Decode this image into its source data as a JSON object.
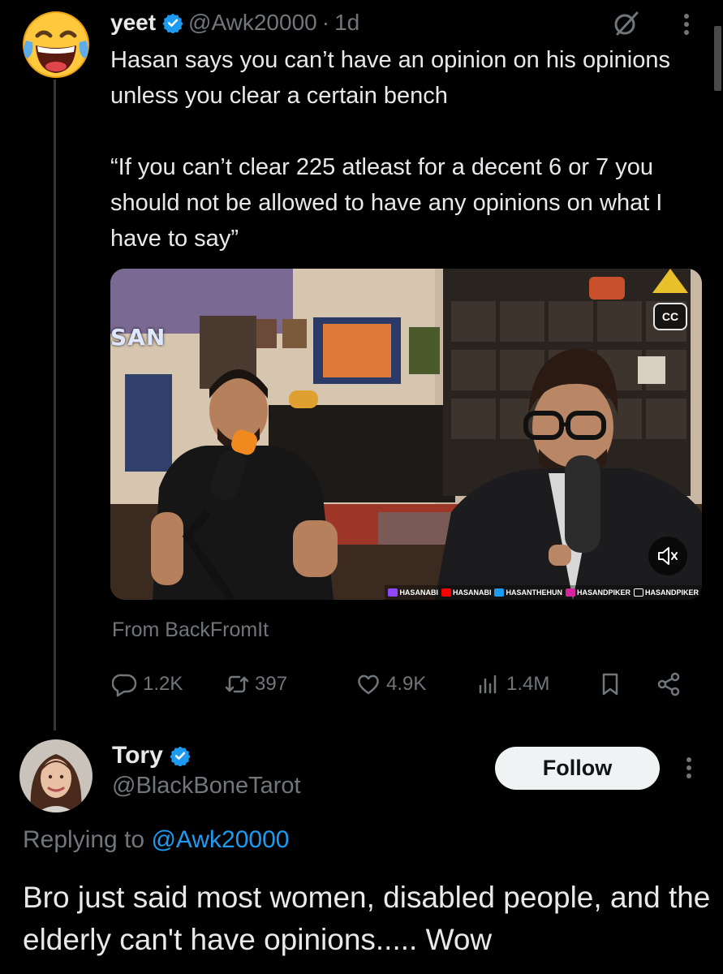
{
  "tweet": {
    "display_name": "yeet",
    "handle": "@Awk20000",
    "time": "1d",
    "text": "Hasan says you can’t have an opinion on his opinions unless you clear a certain bench\n\n“If you can’t clear 225 atleast for a decent 6 or 7 you should not be allowed to have any opinions on what I have to say”",
    "avatar_icon": "laughing-tears-emoji-icon",
    "media": {
      "cc_label": "CC",
      "overlay_label": "SAN",
      "socials": [
        "HASANABI",
        "HASANABI",
        "HASANTHEHUN",
        "HASANDPIKER",
        "HASANDPIKER"
      ]
    },
    "source_attribution": "From BackFromIt",
    "stats": {
      "replies": "1.2K",
      "reposts": "397",
      "likes": "4.9K",
      "views": "1.4M"
    }
  },
  "reply": {
    "display_name": "Tory",
    "handle": "@BlackBoneTarot",
    "follow_label": "Follow",
    "replying_prefix": "Replying to",
    "replying_to": "@Awk20000",
    "text": "Bro just said most women, disabled people, and the elderly can't have opinions..... Wow"
  },
  "colors": {
    "background": "#000000",
    "text": "#e7e9ea",
    "secondary": "#71767b",
    "accent": "#1d9bf0"
  }
}
